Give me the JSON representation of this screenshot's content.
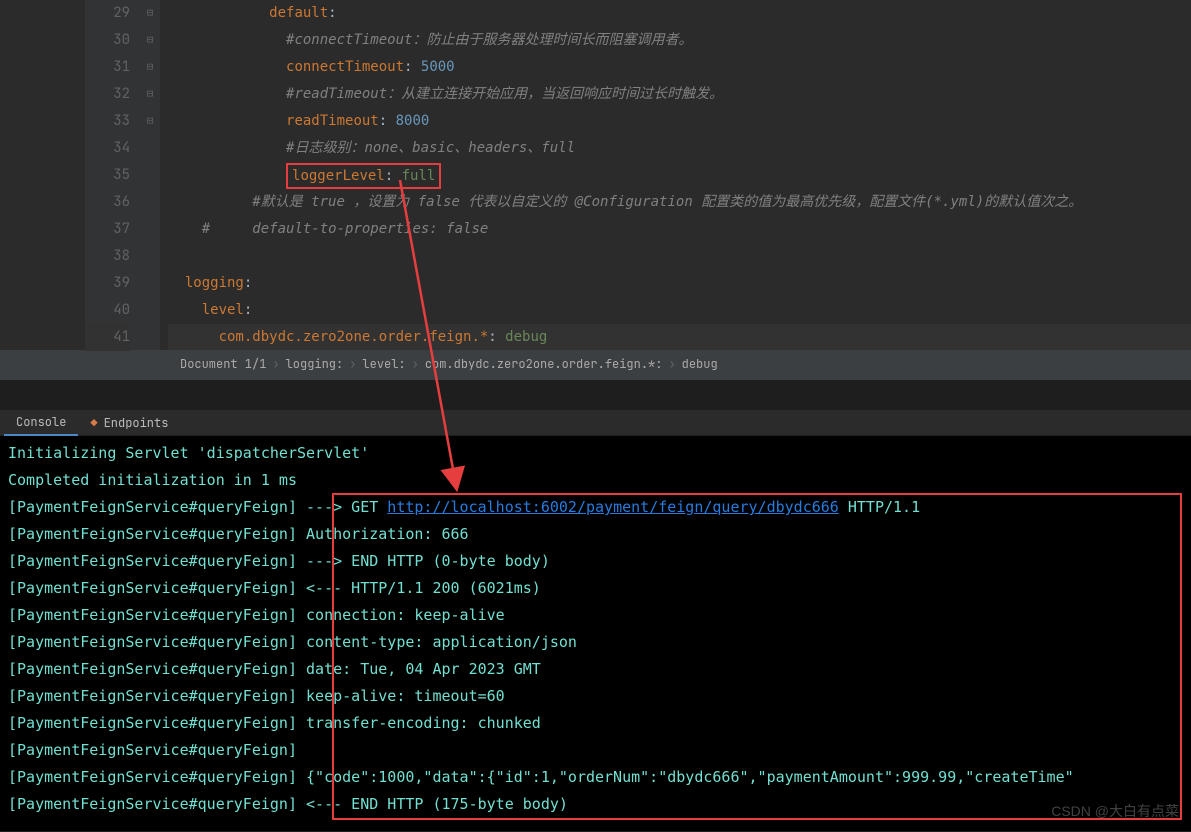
{
  "editor": {
    "lines": [
      {
        "n": 29,
        "fold": "⊟",
        "indent": 12,
        "segs": [
          {
            "t": "default",
            "c": "k-key"
          },
          {
            "t": ":",
            "c": ""
          }
        ]
      },
      {
        "n": 30,
        "fold": "",
        "indent": 14,
        "segs": [
          {
            "t": "#connectTimeout：防止由于服务器处理时间长而阻塞调用者。",
            "c": "k-comment"
          }
        ]
      },
      {
        "n": 31,
        "fold": "",
        "indent": 14,
        "segs": [
          {
            "t": "connectTimeout",
            "c": "k-key"
          },
          {
            "t": ": ",
            "c": ""
          },
          {
            "t": "5000",
            "c": "k-num"
          }
        ]
      },
      {
        "n": 32,
        "fold": "",
        "indent": 14,
        "segs": [
          {
            "t": "#readTimeout：从建立连接开始应用，当返回响应时间过长时触发。",
            "c": "k-comment"
          }
        ]
      },
      {
        "n": 33,
        "fold": "",
        "indent": 14,
        "segs": [
          {
            "t": "readTimeout",
            "c": "k-key"
          },
          {
            "t": ": ",
            "c": ""
          },
          {
            "t": "8000",
            "c": "k-num"
          }
        ]
      },
      {
        "n": 34,
        "fold": "",
        "indent": 14,
        "segs": [
          {
            "t": "#日志级别：none、basic、headers、full",
            "c": "k-comment"
          }
        ]
      },
      {
        "n": 35,
        "fold": "⊟",
        "indent": 14,
        "box": true,
        "segs": [
          {
            "t": "loggerLevel",
            "c": "k-key"
          },
          {
            "t": ": ",
            "c": ""
          },
          {
            "t": "full",
            "c": "k-string"
          }
        ]
      },
      {
        "n": 36,
        "fold": "",
        "indent": 10,
        "segs": [
          {
            "t": "#默认是 ",
            "c": "k-comment"
          },
          {
            "t": "true",
            "c": "k-comment"
          },
          {
            "t": " ，设置为 ",
            "c": "k-comment"
          },
          {
            "t": "false",
            "c": "k-comment"
          },
          {
            "t": " 代表以自定义的 ",
            "c": "k-comment"
          },
          {
            "t": "@Configuration",
            "c": "k-comment"
          },
          {
            "t": " 配置类的值为最高优先级，配置文件(*.yml)的默认值次之。",
            "c": "k-comment"
          }
        ]
      },
      {
        "n": 37,
        "fold": "⊟",
        "indent": 4,
        "segs": [
          {
            "t": "#",
            "c": "k-comment"
          },
          {
            "t": "     default-to-properties: false",
            "c": "k-comment"
          }
        ]
      },
      {
        "n": 38,
        "fold": "",
        "indent": 0,
        "segs": []
      },
      {
        "n": 39,
        "fold": "⊟",
        "indent": 2,
        "segs": [
          {
            "t": "logging",
            "c": "k-key"
          },
          {
            "t": ":",
            "c": ""
          }
        ]
      },
      {
        "n": 40,
        "fold": "⊟",
        "indent": 4,
        "segs": [
          {
            "t": "level",
            "c": "k-key"
          },
          {
            "t": ":",
            "c": ""
          }
        ]
      },
      {
        "n": 41,
        "fold": "",
        "indent": 6,
        "cursor": true,
        "segs": [
          {
            "t": "com.dbydc.zero2one.order.feign.*",
            "c": "k-key"
          },
          {
            "t": ": ",
            "c": ""
          },
          {
            "t": "debug",
            "c": "k-string"
          }
        ]
      }
    ]
  },
  "breadcrumb": {
    "items": [
      "Document 1/1",
      "logging:",
      "level:",
      "com.dbydc.zero2one.order.feign.*:",
      "debug"
    ]
  },
  "tabs": {
    "console": "Console",
    "endpoints": "Endpoints"
  },
  "console": {
    "init1": "Initializing Servlet 'dispatcherServlet'",
    "init2": "Completed initialization in 1 ms",
    "svc": "[PaymentFeignService#queryFeign]",
    "lines": [
      {
        "pre": "---> GET ",
        "url": "http://localhost:6002/payment/feign/query/dbydc666",
        "post": " HTTP/1.1"
      },
      {
        "text": "Authorization: 666"
      },
      {
        "text": "---> END HTTP (0-byte body)"
      },
      {
        "text": "<--- HTTP/1.1 200 (6021ms)"
      },
      {
        "text": "connection: keep-alive"
      },
      {
        "text": "content-type: application/json"
      },
      {
        "text": "date: Tue, 04 Apr 2023 ",
        "redact": "        ",
        "post2": " GMT"
      },
      {
        "text": "keep-alive: timeout=60"
      },
      {
        "text": "transfer-encoding: chunked"
      },
      {
        "text": ""
      },
      {
        "text": "{\"code\":1000,\"data\":{\"id\":1,\"orderNum\":\"dbydc666\",\"paymentAmount\":999.99,\"createTime\""
      },
      {
        "text": "<--- END HTTP (175-byte body)"
      }
    ]
  },
  "watermark": "CSDN @大白有点菜"
}
